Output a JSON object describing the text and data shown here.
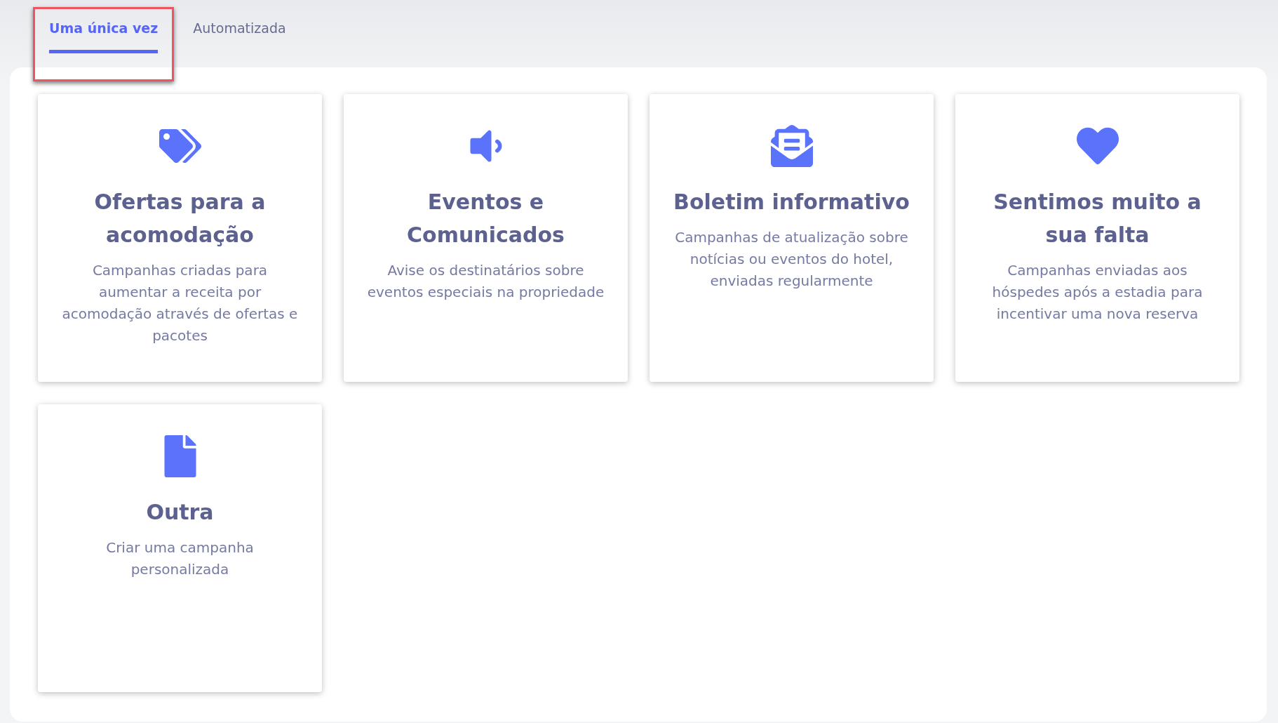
{
  "tabs": [
    {
      "label": "Uma única vez",
      "selected": true,
      "highlighted": true
    },
    {
      "label": "Automatizada",
      "selected": false,
      "highlighted": false
    }
  ],
  "cards": [
    {
      "kind": "tags",
      "title": "Ofertas para a acomodação",
      "description": "Campanhas criadas para aumentar a receita por acomodação através de ofertas e pacotes"
    },
    {
      "kind": "megaphone",
      "title": "Eventos e Comunicados",
      "description": "Avise os destinatários sobre eventos especiais na propriedade"
    },
    {
      "kind": "envelope",
      "title": "Boletim informativo",
      "description": "Campanhas de atualização sobre notícias ou eventos do hotel, enviadas regularmente"
    },
    {
      "kind": "heart",
      "title": "Sentimos muito a sua falta",
      "description": "Campanhas enviadas aos hóspedes após a estadia para incentivar uma nova reserva"
    },
    {
      "kind": "document",
      "title": "Outra",
      "description": "Criar uma campanha personalizada"
    }
  ]
}
